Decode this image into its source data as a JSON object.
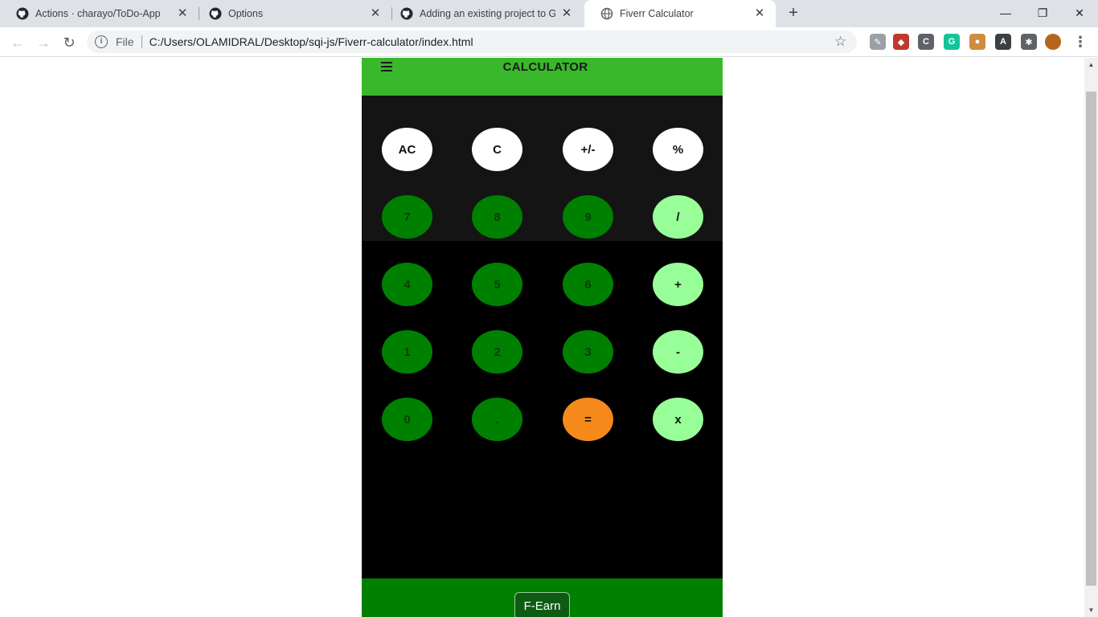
{
  "browser": {
    "tabs": [
      {
        "title": "Actions · charayo/ToDo-App",
        "icon": "github-icon",
        "active": false
      },
      {
        "title": "Options",
        "icon": "github-icon",
        "active": false
      },
      {
        "title": "Adding an existing project to GitHub",
        "icon": "github-icon",
        "active": false
      },
      {
        "title": "Fiverr Calculator",
        "icon": "globe-icon",
        "active": true
      }
    ],
    "new_tab_label": "+",
    "window_controls": {
      "minimize": "—",
      "restore": "❐",
      "close": "✕"
    },
    "address": {
      "info_icon": "i",
      "scheme_label": "File",
      "url": "C:/Users/OLAMIDRAL/Desktop/sqi-js/Fiverr-calculator/index.html",
      "bookmark_icon": "star-icon"
    },
    "extensions": [
      {
        "name": "pen-extension-icon",
        "glyph": "✎",
        "color": "#9aa0a6"
      },
      {
        "name": "cube-extension-icon",
        "glyph": "◆",
        "color": "#c0392b"
      },
      {
        "name": "c-extension-icon",
        "glyph": "C",
        "color": "#5f6368"
      },
      {
        "name": "grammarly-extension-icon",
        "glyph": "G",
        "color": "#15c39a"
      },
      {
        "name": "cookie-extension-icon",
        "glyph": "●",
        "color": "#d08c3e"
      },
      {
        "name": "font-extension-icon",
        "glyph": "A",
        "color": "#3c4043"
      },
      {
        "name": "puzzle-extensions-icon",
        "glyph": "✱",
        "color": "#5f6368"
      }
    ],
    "menu_icon": "⋮"
  },
  "calculator": {
    "title": "CALCULATOR",
    "display_value": "",
    "keys": [
      {
        "label": "AC",
        "kind": "fn"
      },
      {
        "label": "C",
        "kind": "fn"
      },
      {
        "label": "+/-",
        "kind": "fn"
      },
      {
        "label": "%",
        "kind": "fn"
      },
      {
        "label": "7",
        "kind": "num"
      },
      {
        "label": "8",
        "kind": "num"
      },
      {
        "label": "9",
        "kind": "num"
      },
      {
        "label": "/",
        "kind": "op"
      },
      {
        "label": "4",
        "kind": "num"
      },
      {
        "label": "5",
        "kind": "num"
      },
      {
        "label": "6",
        "kind": "num"
      },
      {
        "label": "+",
        "kind": "op"
      },
      {
        "label": "1",
        "kind": "num"
      },
      {
        "label": "2",
        "kind": "num"
      },
      {
        "label": "3",
        "kind": "num"
      },
      {
        "label": "-",
        "kind": "op"
      },
      {
        "label": "0",
        "kind": "num"
      },
      {
        "label": ".",
        "kind": "num"
      },
      {
        "label": "=",
        "kind": "eq"
      },
      {
        "label": "x",
        "kind": "op"
      }
    ],
    "footer_button": "F-Earn",
    "colors": {
      "header": "#38b82a",
      "number_key": "#008000",
      "operator_key": "#98ff98",
      "equals_key": "#f5891a",
      "function_key": "#ffffff"
    }
  }
}
